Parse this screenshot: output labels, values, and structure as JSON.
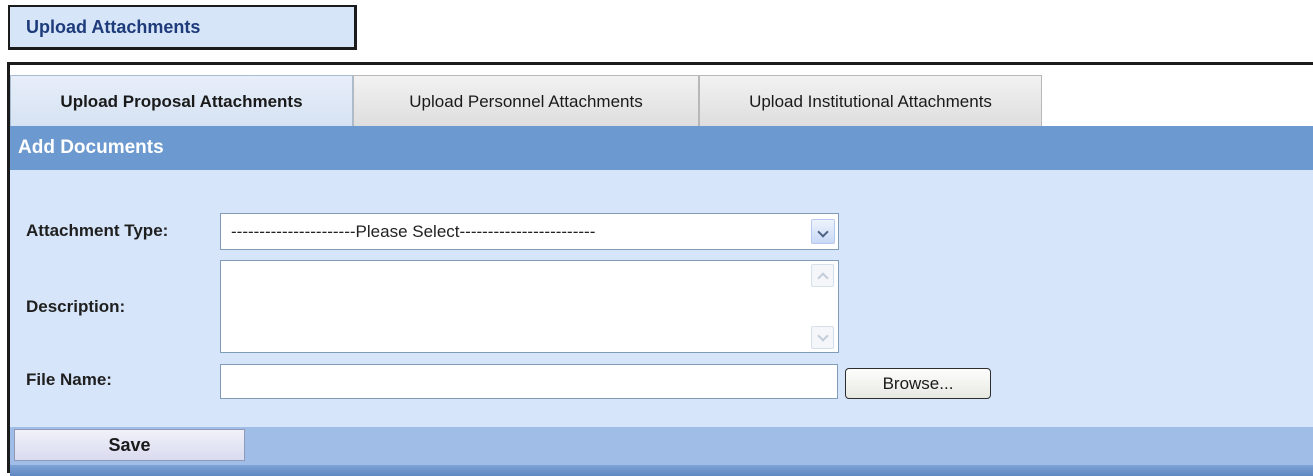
{
  "page_title": "Upload Attachments",
  "tabs": [
    {
      "label": "Upload Proposal Attachments",
      "active": true
    },
    {
      "label": "Upload Personnel Attachments",
      "active": false
    },
    {
      "label": "Upload Institutional Attachments",
      "active": false
    }
  ],
  "section": {
    "title": "Add Documents"
  },
  "form": {
    "attachment_type": {
      "label": "Attachment Type:",
      "value": "----------------------Please Select------------------------"
    },
    "description": {
      "label": "Description:",
      "value": ""
    },
    "file_name": {
      "label": "File Name:",
      "value": "",
      "browse_label": "Browse..."
    }
  },
  "footer": {
    "save_label": "Save"
  },
  "colors": {
    "header_blue": "#6c99cf",
    "panel_bg": "#d6e5f9",
    "title_text": "#1e3c7b"
  }
}
